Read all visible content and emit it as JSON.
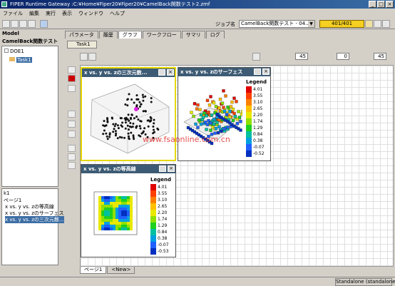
{
  "window": {
    "title": "FIPER Runtime Gateway :C:¥Home¥Fiper20¥Fiper20¥CamelBack関数テスト2.zmf"
  },
  "menu": [
    "ファイル",
    "編集",
    "実行",
    "表示",
    "ウィンドウ",
    "ヘルプ"
  ],
  "toolbar": {
    "job_label": "ジョブ名",
    "job_value": "CamelBack関数テスト - 04...",
    "progress": "401/401"
  },
  "left": {
    "header": "Model",
    "model_title": "CamelBack関数テスト",
    "tree": [
      "DOE1",
      "Task1"
    ],
    "bottom": [
      "k1",
      "ページ1",
      "x vs. y vs. zの等高線",
      "x vs. y vs. zのサーフェス",
      "x vs. y vs. zの三次元散..."
    ]
  },
  "tabs": [
    "パラメータ",
    "履歴",
    "グラフ",
    "ワークフロー",
    "サマリ",
    "ログ"
  ],
  "subtab": "Task1",
  "spinners": [
    "45",
    "0",
    "45"
  ],
  "charts": {
    "scatter": {
      "title": "x vs. y vs. zの三次元散..."
    },
    "surface": {
      "title": "x vs. y vs. zのサーフェス",
      "legend": "Legend",
      "levels": [
        "4.01",
        "3.55",
        "3.10",
        "2.65",
        "2.20",
        "1.74",
        "1.29",
        "0.84",
        "0.38",
        "-0.07",
        "-0.52"
      ]
    },
    "contour": {
      "title": "x vs. y vs. zの等高線",
      "legend": "Legend",
      "levels": [
        "4.01",
        "3.55",
        "3.10",
        "2.65",
        "2.20",
        "1.74",
        "1.29",
        "0.84",
        "0.38",
        "-0.07",
        "-0.53"
      ]
    }
  },
  "pages": [
    "ページ1",
    "<New>"
  ],
  "status": "Standalone (standalone)",
  "watermark": "www.fsaonline.com.cn"
}
